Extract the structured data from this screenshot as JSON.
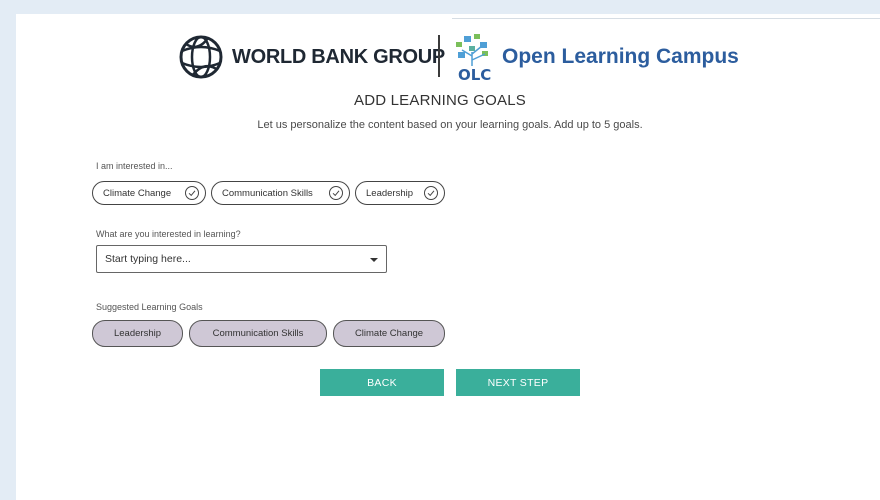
{
  "header": {
    "wbg_logo_text": "WORLD BANK GROUP",
    "olc_logo_text": "Open Learning Campus",
    "olc_mark_text": "OLC"
  },
  "page": {
    "title": "ADD LEARNING GOALS",
    "subtitle": "Let us personalize the content based on your learning goals. Add up to 5 goals."
  },
  "interests": {
    "label": "I am interested in...",
    "chips": [
      {
        "label": "Climate Change",
        "selected": true
      },
      {
        "label": "Communication Skills",
        "selected": true
      },
      {
        "label": "Leadership",
        "selected": true
      }
    ]
  },
  "search": {
    "label": "What are you interested in learning?",
    "placeholder": "Start typing here..."
  },
  "suggested": {
    "label": "Suggested Learning Goals",
    "items": [
      "Leadership",
      "Communication Skills",
      "Climate Change"
    ]
  },
  "actions": {
    "back_label": "BACK",
    "next_label": "NEXT STEP"
  },
  "colors": {
    "accent": "#3aaf9b",
    "brand_blue": "#2c5d9e",
    "suggestion_bg": "#cfc8d6",
    "page_bg": "#e3ecf5"
  }
}
